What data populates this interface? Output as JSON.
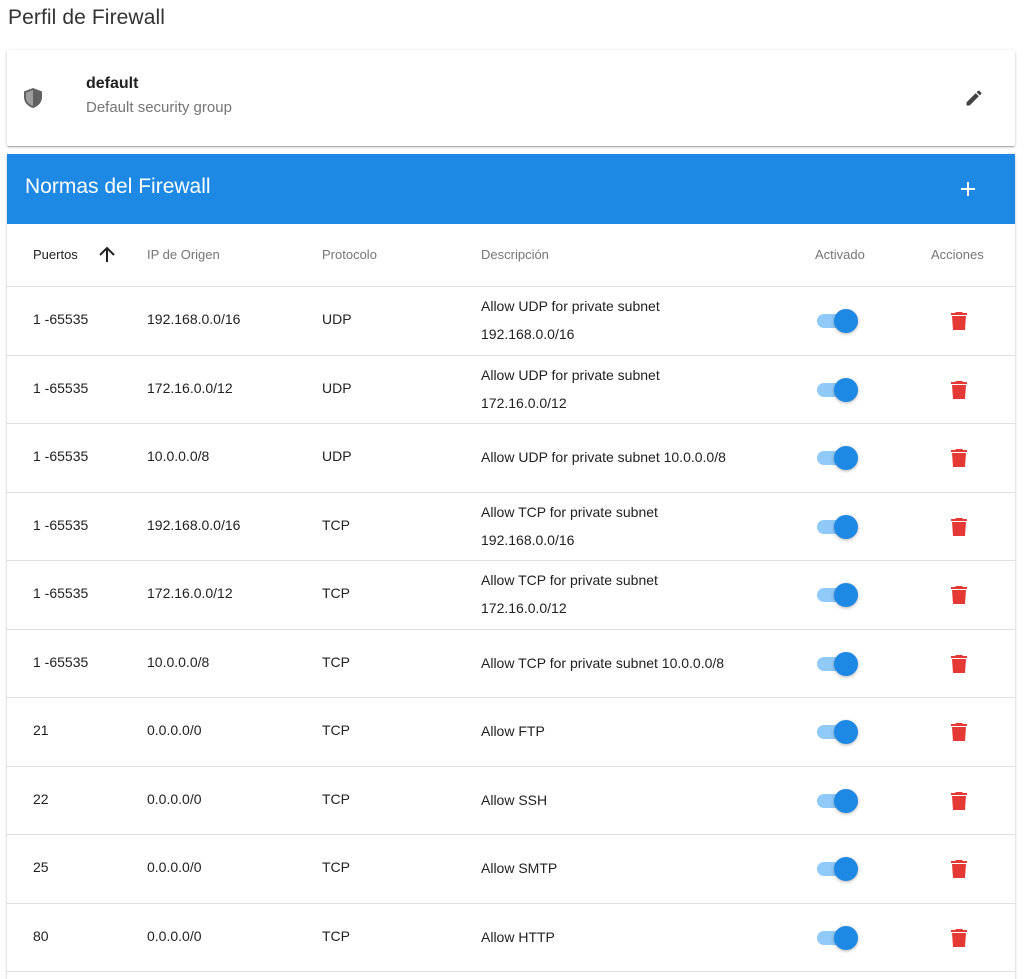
{
  "page": {
    "title": "Perfil de Firewall"
  },
  "profile": {
    "name": "default",
    "description": "Default security group",
    "icon": "shield-icon",
    "edit_icon": "pencil-icon"
  },
  "rules_panel": {
    "title": "Normas del Firewall",
    "add_icon": "plus-icon",
    "columns": {
      "ports": "Puertos",
      "source_ip": "IP de Origen",
      "protocol": "Protocolo",
      "description": "Descripción",
      "enabled": "Activado",
      "actions": "Acciones"
    },
    "sort": {
      "column": "ports",
      "direction": "ascending"
    },
    "rows": [
      {
        "ports": "1 -65535",
        "source_ip": "192.168.0.0/16",
        "protocol": "UDP",
        "desc_line1": "Allow UDP for private subnet",
        "desc_line2": "192.168.0.0/16",
        "enabled": true
      },
      {
        "ports": "1 -65535",
        "source_ip": "172.16.0.0/12",
        "protocol": "UDP",
        "desc_line1": "Allow UDP for private subnet",
        "desc_line2": "172.16.0.0/12",
        "enabled": true
      },
      {
        "ports": "1 -65535",
        "source_ip": "10.0.0.0/8",
        "protocol": "UDP",
        "desc_line1": "Allow UDP for private subnet 10.0.0.0/8",
        "desc_line2": "",
        "enabled": true
      },
      {
        "ports": "1 -65535",
        "source_ip": "192.168.0.0/16",
        "protocol": "TCP",
        "desc_line1": "Allow TCP for private subnet",
        "desc_line2": "192.168.0.0/16",
        "enabled": true
      },
      {
        "ports": "1 -65535",
        "source_ip": "172.16.0.0/12",
        "protocol": "TCP",
        "desc_line1": "Allow TCP for private subnet",
        "desc_line2": "172.16.0.0/12",
        "enabled": true
      },
      {
        "ports": "1 -65535",
        "source_ip": "10.0.0.0/8",
        "protocol": "TCP",
        "desc_line1": "Allow TCP for private subnet 10.0.0.0/8",
        "desc_line2": "",
        "enabled": true
      },
      {
        "ports": "21",
        "source_ip": "0.0.0.0/0",
        "protocol": "TCP",
        "desc_line1": "Allow FTP",
        "desc_line2": "",
        "enabled": true
      },
      {
        "ports": "22",
        "source_ip": "0.0.0.0/0",
        "protocol": "TCP",
        "desc_line1": "Allow SSH",
        "desc_line2": "",
        "enabled": true
      },
      {
        "ports": "25",
        "source_ip": "0.0.0.0/0",
        "protocol": "TCP",
        "desc_line1": "Allow SMTP",
        "desc_line2": "",
        "enabled": true
      },
      {
        "ports": "80",
        "source_ip": "0.0.0.0/0",
        "protocol": "TCP",
        "desc_line1": "Allow HTTP",
        "desc_line2": "",
        "enabled": true
      }
    ]
  },
  "colors": {
    "primary": "#1e88e5",
    "toggle_track": "#90caf9",
    "delete": "#e53935",
    "icon_gray": "#616161"
  }
}
